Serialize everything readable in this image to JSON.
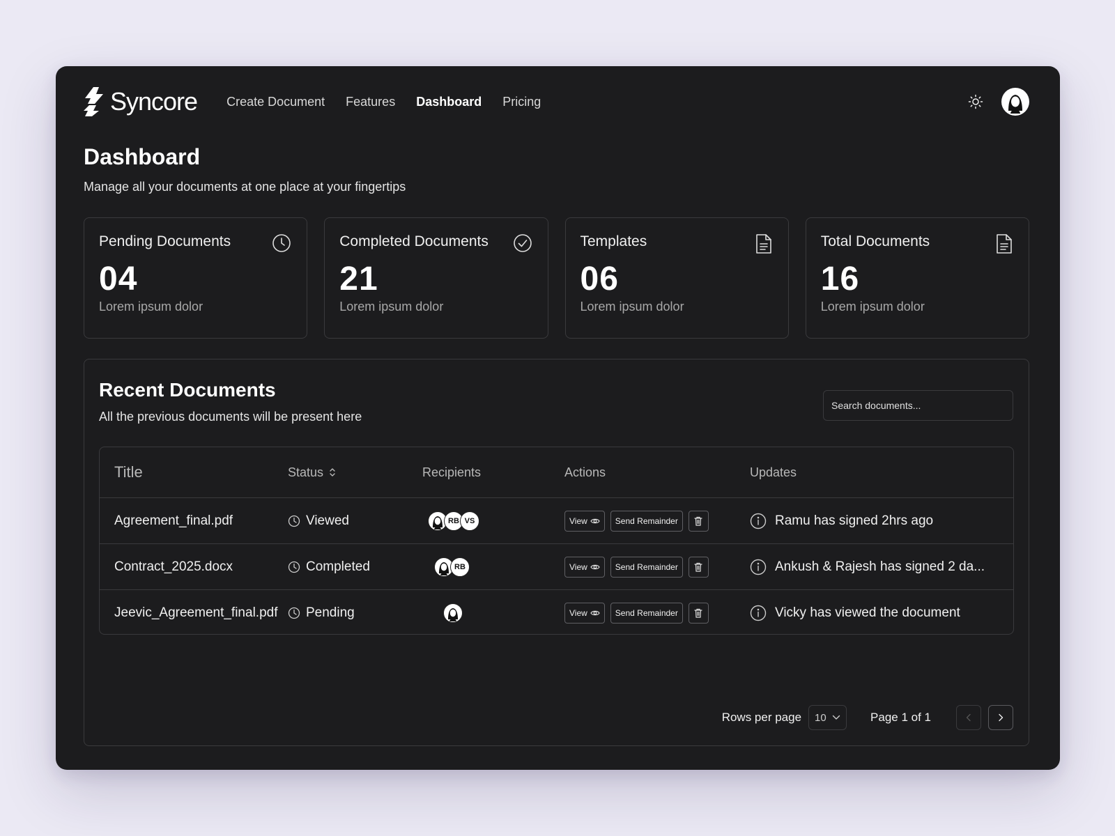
{
  "app": {
    "name": "Syncore"
  },
  "nav": {
    "links": [
      {
        "label": "Create Document"
      },
      {
        "label": "Features"
      },
      {
        "label": "Dashboard"
      },
      {
        "label": "Pricing"
      }
    ],
    "theme_icon": "sun-icon",
    "avatar_icon": "user-avatar"
  },
  "page": {
    "title": "Dashboard",
    "subtitle": "Manage all your documents at one place at your fingertips"
  },
  "stats": [
    {
      "title": "Pending Documents",
      "value": "04",
      "sub": "Lorem ipsum dolor",
      "icon": "clock-icon"
    },
    {
      "title": "Completed Documents",
      "value": "21",
      "sub": "Lorem ipsum dolor",
      "icon": "check-circle-icon"
    },
    {
      "title": "Templates",
      "value": "06",
      "sub": "Lorem ipsum dolor",
      "icon": "document-icon"
    },
    {
      "title": "Total Documents",
      "value": "16",
      "sub": "Lorem ipsum dolor",
      "icon": "document-icon"
    }
  ],
  "recent": {
    "title": "Recent Documents",
    "subtitle": "All the previous documents will be present here",
    "search_placeholder": "Search documents...",
    "columns": {
      "title": "Title",
      "status": "Status",
      "recipients": "Recipients",
      "actions": "Actions",
      "updates": "Updates"
    },
    "view_label": "View",
    "remind_label": "Send Remainder",
    "rows": [
      {
        "title": "Agreement_final.pdf",
        "status": "Viewed",
        "recipients": [
          "avatar",
          "RB",
          "VS"
        ],
        "update": "Ramu has signed 2hrs ago"
      },
      {
        "title": "Contract_2025.docx",
        "status": "Completed",
        "recipients": [
          "avatar",
          "RB"
        ],
        "update": "Ankush & Rajesh has signed 2 da..."
      },
      {
        "title": "Jeevic_Agreement_final.pdf",
        "status": "Pending",
        "recipients": [
          "avatar"
        ],
        "update": "Vicky has viewed the document"
      }
    ]
  },
  "pagination": {
    "rows_label": "Rows per page",
    "rows_value": "10",
    "page_info": "Page 1 of 1"
  }
}
